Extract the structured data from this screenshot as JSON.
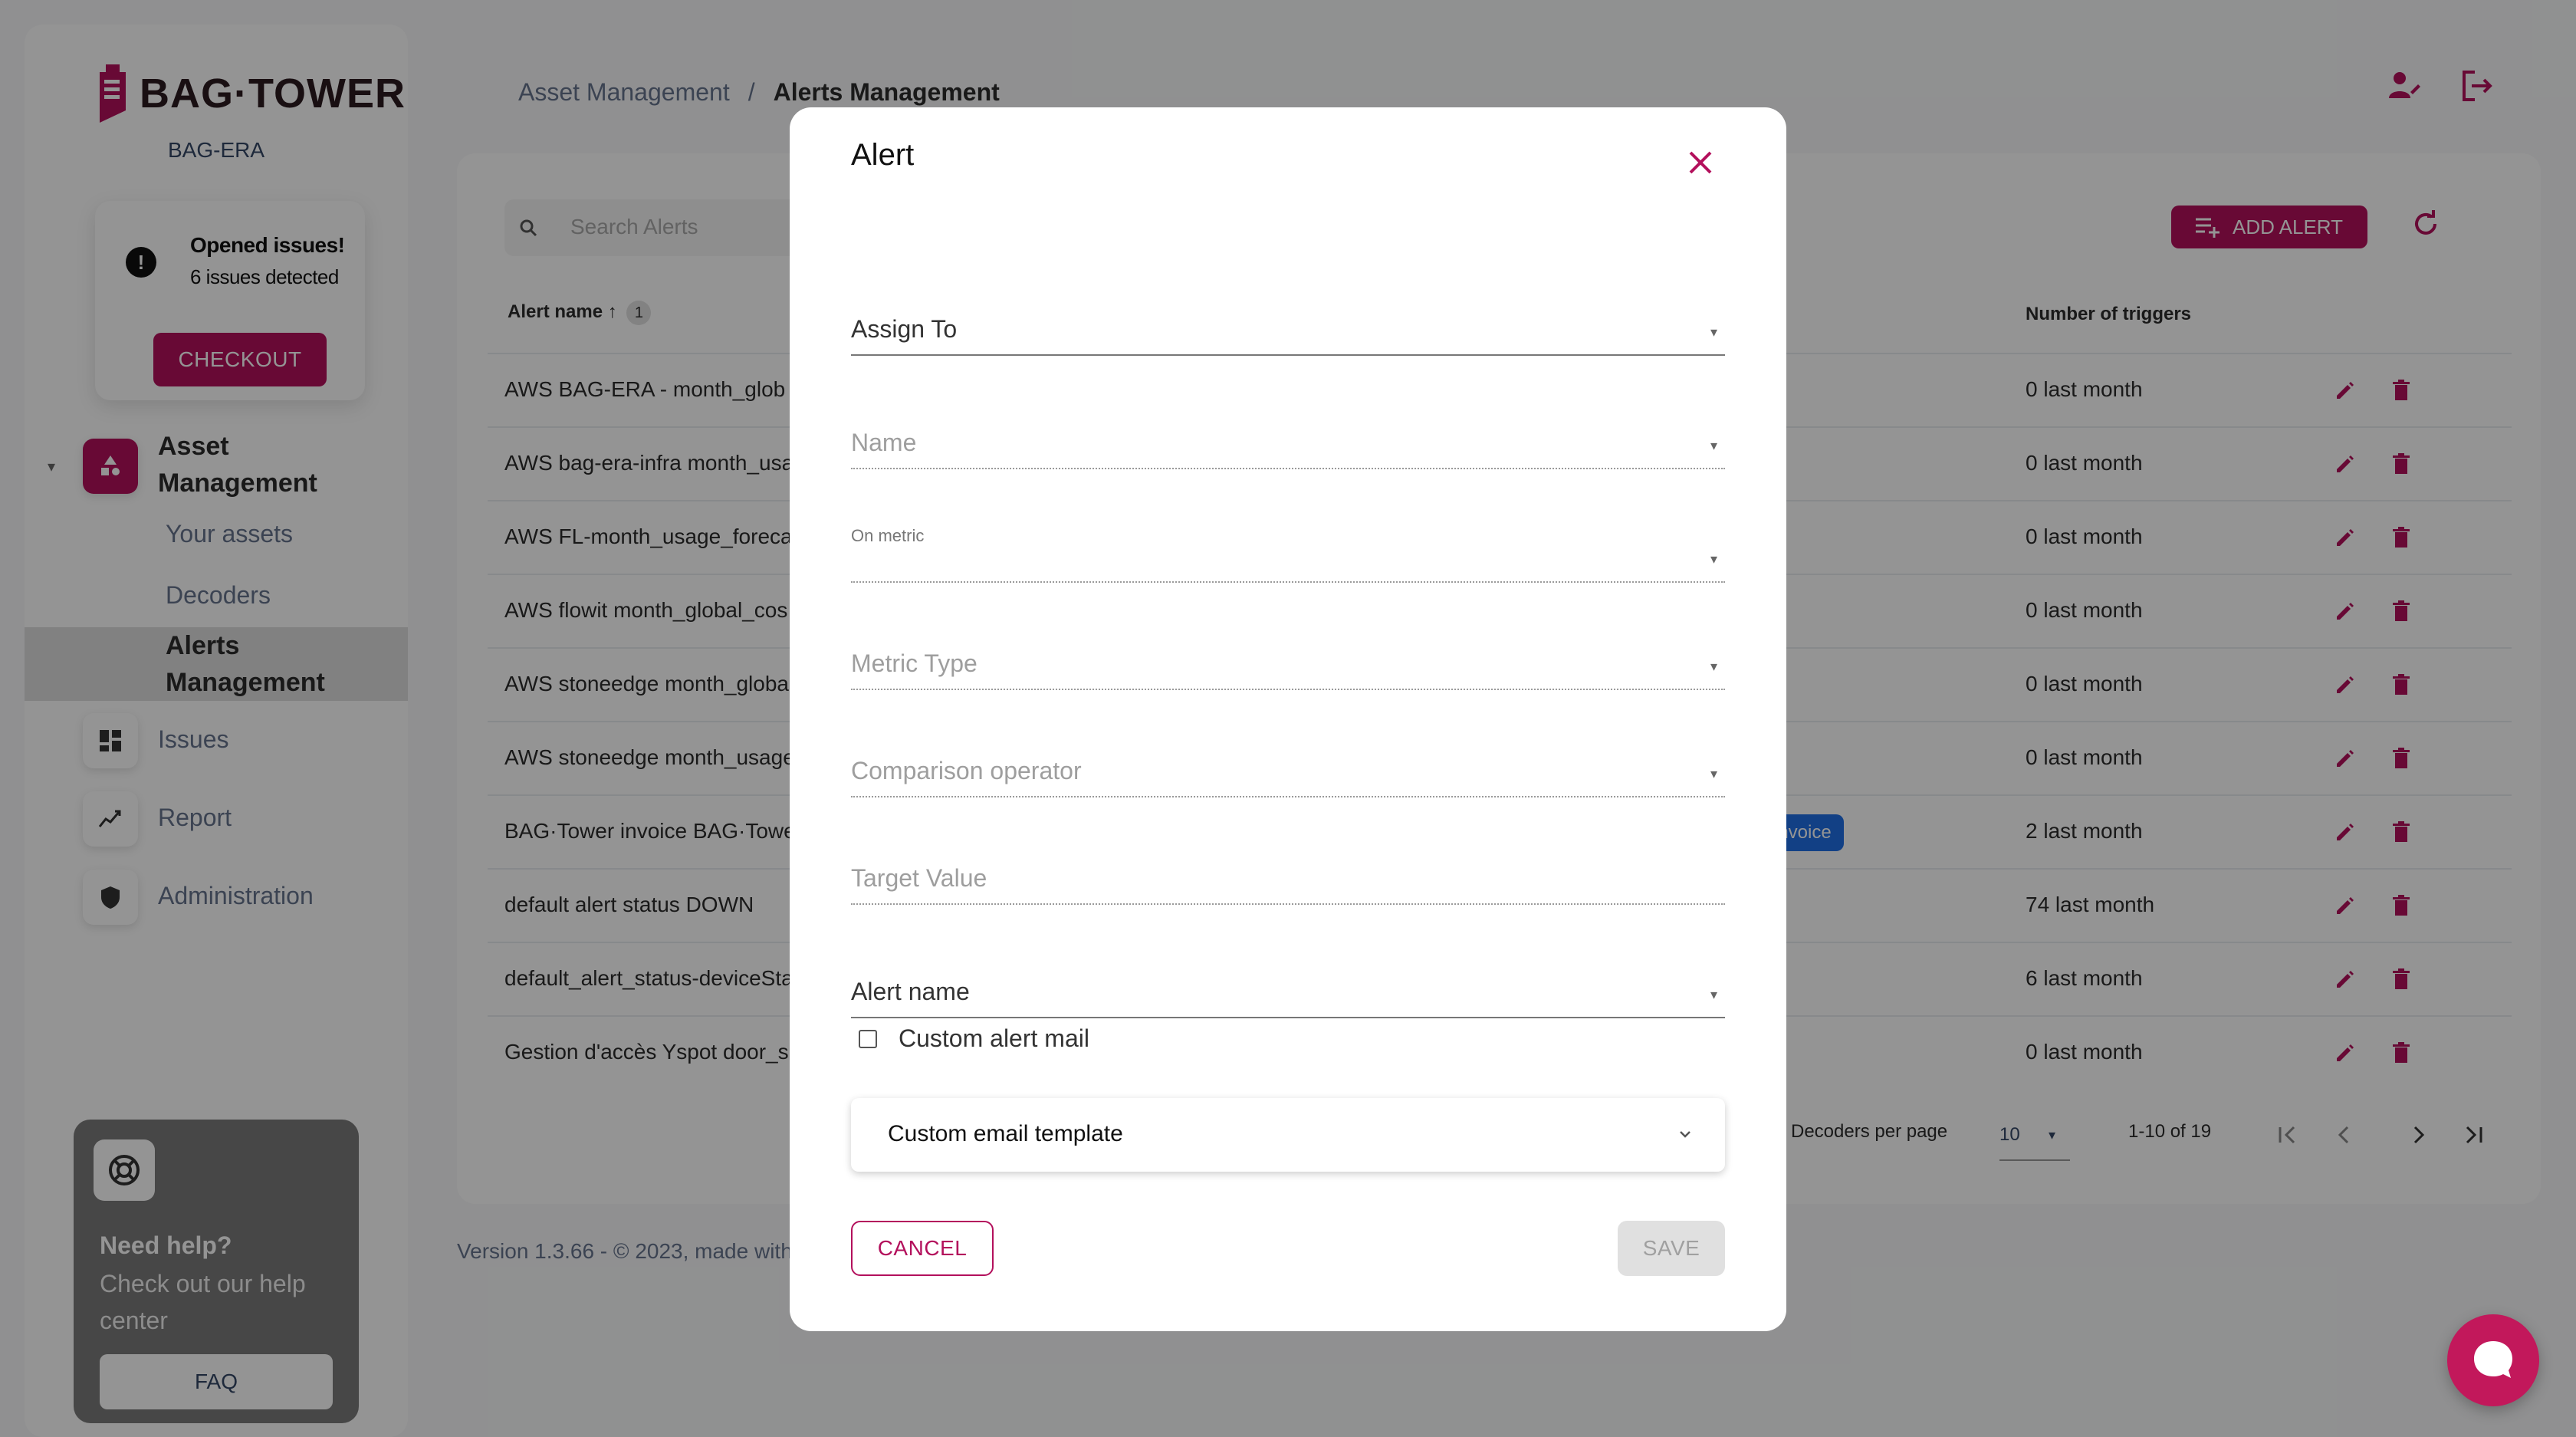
{
  "brand": {
    "name": "BAG·TOWER",
    "org": "BAG-ERA"
  },
  "issues": {
    "title": "Opened issues!",
    "subtitle": "6 issues detected",
    "button": "CHECKOUT"
  },
  "nav": {
    "asset_management": "Asset Management",
    "your_assets": "Your assets",
    "decoders": "Decoders",
    "alerts_management": "Alerts Management",
    "issues": "Issues",
    "report": "Report",
    "administration": "Administration"
  },
  "help": {
    "title": "Need help?",
    "subtitle": "Check out our help center",
    "button": "FAQ"
  },
  "breadcrumb": {
    "parent": "Asset Management",
    "separator": "/",
    "current": "Alerts Management"
  },
  "toolbar": {
    "search_placeholder": "Search Alerts",
    "add_alert": "ADD ALERT"
  },
  "table": {
    "headers": {
      "name": "Alert name",
      "sort_badge": "1",
      "triggers": "Number of triggers"
    },
    "rows": [
      {
        "name": "AWS BAG-ERA - month_glob",
        "triggers": "0 last month"
      },
      {
        "name": "AWS bag-era-infra month_usa",
        "triggers": "0 last month"
      },
      {
        "name": "AWS FL-month_usage_foreca",
        "triggers": "0 last month"
      },
      {
        "name": "AWS flowit month_global_cos",
        "triggers": "0 last month"
      },
      {
        "name": "AWS stoneedge month_globa",
        "triggers": "0 last month"
      },
      {
        "name": "AWS stoneedge month_usage",
        "triggers": "0 last month"
      },
      {
        "name": "BAG·Tower invoice BAG·Towe",
        "triggers": "2 last month",
        "chip": "invoice"
      },
      {
        "name": "default alert status DOWN",
        "triggers": "74 last month"
      },
      {
        "name": "default_alert_status-deviceSta",
        "triggers": "6 last month"
      },
      {
        "name": "Gestion d'accès Yspot door_s",
        "triggers": "0 last month"
      }
    ]
  },
  "pagination": {
    "per_page_label": "Decoders per page",
    "per_page_value": "10",
    "range": "1-10 of 19"
  },
  "footer": {
    "version": "Version 1.3.66 - © 2023, made with"
  },
  "modal": {
    "title": "Alert",
    "fields": {
      "assign_to": "Assign To",
      "name": "Name",
      "on_metric": "On metric",
      "metric_type": "Metric Type",
      "comparison_operator": "Comparison operator",
      "target_value": "Target Value",
      "alert_name": "Alert name"
    },
    "custom_mail_label": "Custom alert mail",
    "template_select": "Custom email template",
    "cancel": "CANCEL",
    "save": "SAVE"
  },
  "colors": {
    "accent": "#b3105c",
    "chip_blue": "#1f6fe5",
    "overlay": "rgba(0,0,0,0.42)"
  }
}
